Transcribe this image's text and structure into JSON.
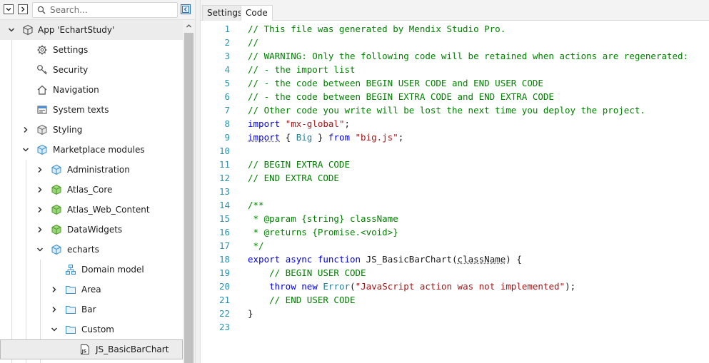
{
  "left_panel": {
    "search": {
      "placeholder": "Search..."
    },
    "toolbar_icons": [
      "collapse-all-icon",
      "expand-all-icon",
      "sync-explorer-icon"
    ],
    "tree": [
      {
        "label": "App 'EchartStudy'",
        "icon": "app-cube-icon",
        "expanded": true
      },
      {
        "label": "Settings",
        "icon": "gear-icon"
      },
      {
        "label": "Security",
        "icon": "key-icon"
      },
      {
        "label": "Navigation",
        "icon": "home-icon"
      },
      {
        "label": "System texts",
        "icon": "system-texts-icon"
      },
      {
        "label": "Styling",
        "icon": "styling-cube-icon",
        "expanded": false
      },
      {
        "label": "Marketplace modules",
        "icon": "marketplace-cube-icon",
        "expanded": true
      },
      {
        "label": "Administration",
        "icon": "module-icon",
        "expanded": false
      },
      {
        "label": "Atlas_Core",
        "icon": "module-green-icon",
        "expanded": false
      },
      {
        "label": "Atlas_Web_Content",
        "icon": "module-green-icon",
        "expanded": false
      },
      {
        "label": "DataWidgets",
        "icon": "module-green-icon",
        "expanded": false
      },
      {
        "label": "echarts",
        "icon": "module-icon",
        "expanded": true
      },
      {
        "label": "Domain model",
        "icon": "domain-model-icon"
      },
      {
        "label": "Area",
        "icon": "folder-icon",
        "expanded": false
      },
      {
        "label": "Bar",
        "icon": "folder-icon",
        "expanded": false
      },
      {
        "label": "Custom",
        "icon": "folder-icon",
        "expanded": true
      },
      {
        "label": "JS_BasicBarChart",
        "icon": "javascript-action-icon",
        "selected": true
      }
    ]
  },
  "editor": {
    "tabs": [
      {
        "label": "Settings",
        "active": false
      },
      {
        "label": "Code",
        "active": true
      }
    ],
    "code_lines": [
      {
        "n": "1",
        "tokens": [
          [
            "com",
            "// This file was generated by Mendix Studio Pro."
          ]
        ]
      },
      {
        "n": "2",
        "tokens": [
          [
            "com",
            "//"
          ]
        ]
      },
      {
        "n": "3",
        "tokens": [
          [
            "com",
            "// WARNING: Only the following code will be retained when actions are regenerated:"
          ]
        ]
      },
      {
        "n": "4",
        "tokens": [
          [
            "com",
            "// - the import list"
          ]
        ]
      },
      {
        "n": "5",
        "tokens": [
          [
            "com",
            "// - the code between BEGIN USER CODE and END USER CODE"
          ]
        ]
      },
      {
        "n": "6",
        "tokens": [
          [
            "com",
            "// - the code between BEGIN EXTRA CODE and END EXTRA CODE"
          ]
        ]
      },
      {
        "n": "7",
        "tokens": [
          [
            "com",
            "// Other code you write will be lost the next time you deploy the project."
          ]
        ]
      },
      {
        "n": "8",
        "tokens": [
          [
            "kw",
            "import"
          ],
          [
            "id",
            " "
          ],
          [
            "str",
            "\"mx-global\""
          ],
          [
            "id",
            ";"
          ]
        ]
      },
      {
        "n": "9",
        "tokens": [
          [
            "kw-sq",
            "import"
          ],
          [
            "id",
            " { "
          ],
          [
            "ty",
            "Big"
          ],
          [
            "id",
            " } "
          ],
          [
            "kw",
            "from"
          ],
          [
            "id",
            " "
          ],
          [
            "str",
            "\"big.js\""
          ],
          [
            "id",
            ";"
          ]
        ]
      },
      {
        "n": "10",
        "tokens": []
      },
      {
        "n": "11",
        "tokens": [
          [
            "com",
            "// BEGIN EXTRA CODE"
          ]
        ]
      },
      {
        "n": "12",
        "tokens": [
          [
            "com",
            "// END EXTRA CODE"
          ]
        ]
      },
      {
        "n": "13",
        "tokens": []
      },
      {
        "n": "14",
        "tokens": [
          [
            "com",
            "/**"
          ]
        ]
      },
      {
        "n": "15",
        "tokens": [
          [
            "com",
            " * @param {string} className"
          ]
        ]
      },
      {
        "n": "16",
        "tokens": [
          [
            "com",
            " * @returns {Promise.<void>}"
          ]
        ]
      },
      {
        "n": "17",
        "tokens": [
          [
            "com",
            " */"
          ]
        ]
      },
      {
        "n": "18",
        "tokens": [
          [
            "kw",
            "export"
          ],
          [
            "id",
            " "
          ],
          [
            "kw",
            "async"
          ],
          [
            "id",
            " "
          ],
          [
            "kw",
            "function"
          ],
          [
            "id",
            " JS_BasicBarChart("
          ],
          [
            "id-sq",
            "className"
          ],
          [
            "id",
            ") {"
          ]
        ]
      },
      {
        "n": "19",
        "tokens": [
          [
            "id",
            "    "
          ],
          [
            "com",
            "// BEGIN USER CODE"
          ]
        ]
      },
      {
        "n": "20",
        "tokens": [
          [
            "id",
            "    "
          ],
          [
            "kw",
            "throw"
          ],
          [
            "id",
            " "
          ],
          [
            "kw",
            "new"
          ],
          [
            "id",
            " "
          ],
          [
            "ty",
            "Error"
          ],
          [
            "id",
            "("
          ],
          [
            "str",
            "\"JavaScript action was not implemented\""
          ],
          [
            "id",
            ");"
          ]
        ]
      },
      {
        "n": "21",
        "tokens": [
          [
            "id",
            "    "
          ],
          [
            "com",
            "// END USER CODE"
          ]
        ]
      },
      {
        "n": "22",
        "tokens": [
          [
            "id",
            "}"
          ]
        ]
      },
      {
        "n": "23",
        "tokens": []
      }
    ]
  },
  "colors": {
    "comment": "#008000",
    "keyword": "#0000ff",
    "string": "#a31515",
    "type": "#267f99",
    "line_number": "#2b91af"
  }
}
